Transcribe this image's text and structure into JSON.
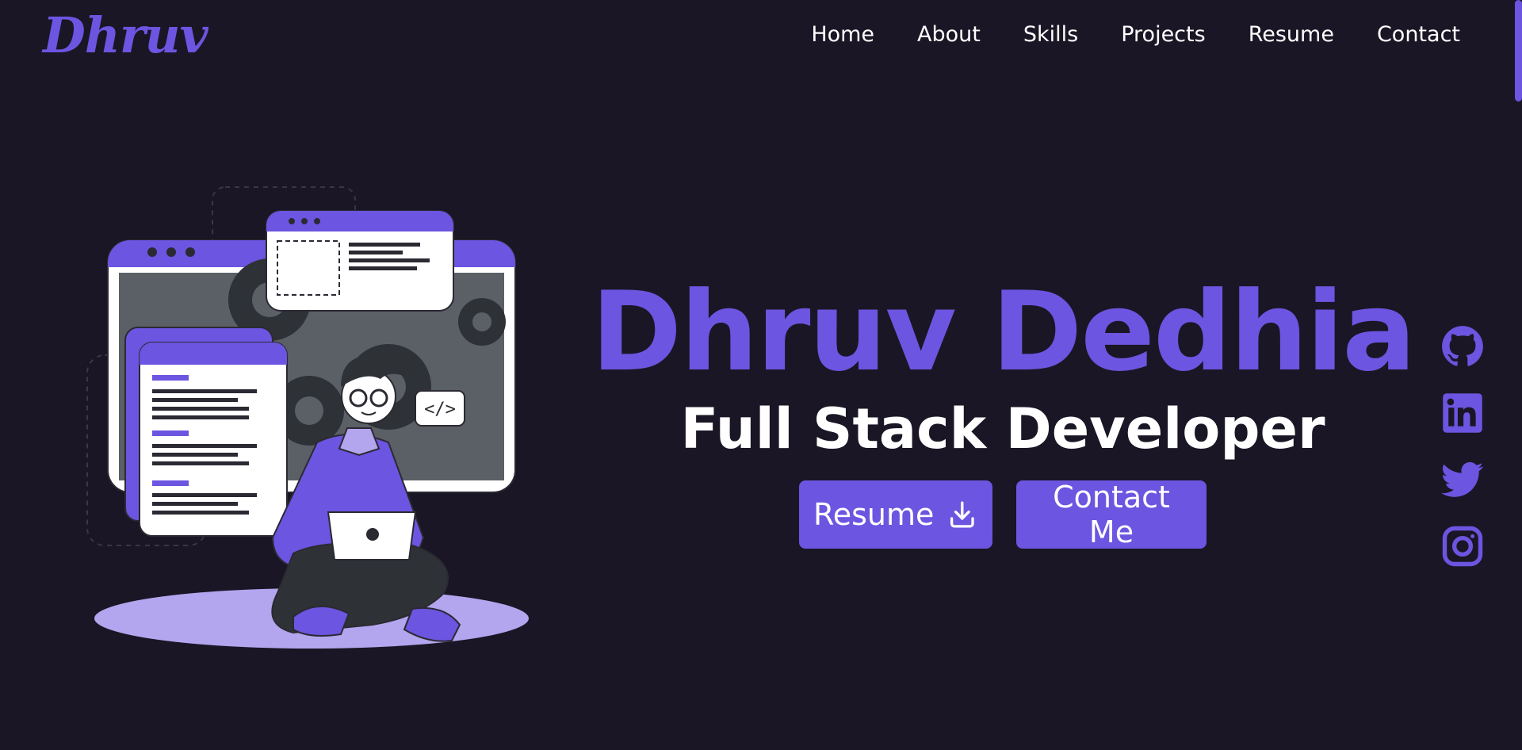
{
  "brand": {
    "logo_text": "Dhruv"
  },
  "nav": {
    "items": [
      {
        "label": "Home"
      },
      {
        "label": "About"
      },
      {
        "label": "Skills"
      },
      {
        "label": "Projects"
      },
      {
        "label": "Resume"
      },
      {
        "label": "Contact"
      }
    ]
  },
  "hero": {
    "name": "Dhruv Dedhia",
    "role": "Full Stack Developer",
    "resume_button": "Resume",
    "contact_button": "Contact Me",
    "illustration_code_tag": "</>"
  },
  "social": {
    "icons": [
      "github-icon",
      "linkedin-icon",
      "twitter-icon",
      "instagram-icon"
    ]
  },
  "colors": {
    "background": "#1a1625",
    "accent": "#6c55e0",
    "accent_light": "#b3a6ee",
    "text": "#ffffff"
  }
}
